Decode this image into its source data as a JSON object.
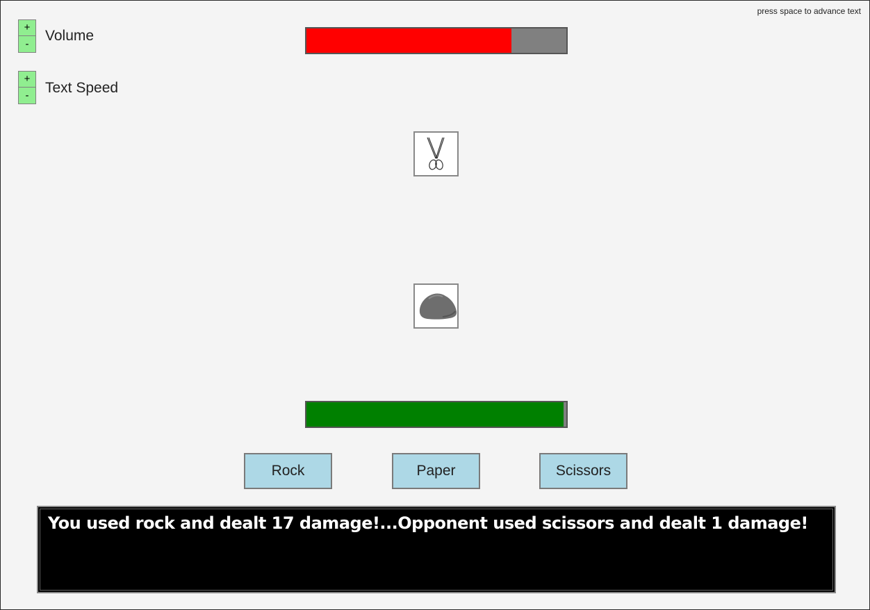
{
  "hint": "press space to advance text",
  "controls": {
    "volume": {
      "label": "Volume",
      "plus": "+",
      "minus": "-"
    },
    "text_speed": {
      "label": "Text Speed",
      "plus": "+",
      "minus": "-"
    }
  },
  "opponent": {
    "hp_fraction": 0.79,
    "hp_color": "#ff0000",
    "move_icon": "scissors-icon"
  },
  "player": {
    "hp_fraction": 0.99,
    "hp_color": "#008000",
    "move_icon": "rock-icon"
  },
  "colors": {
    "hp_empty": "#808080",
    "control_button": "#90ee90",
    "move_button": "#add8e6"
  },
  "moves": {
    "rock": "Rock",
    "paper": "Paper",
    "scissors": "Scissors"
  },
  "message": "You used rock and dealt 17 damage!...Opponent used scissors and dealt 1 damage!"
}
